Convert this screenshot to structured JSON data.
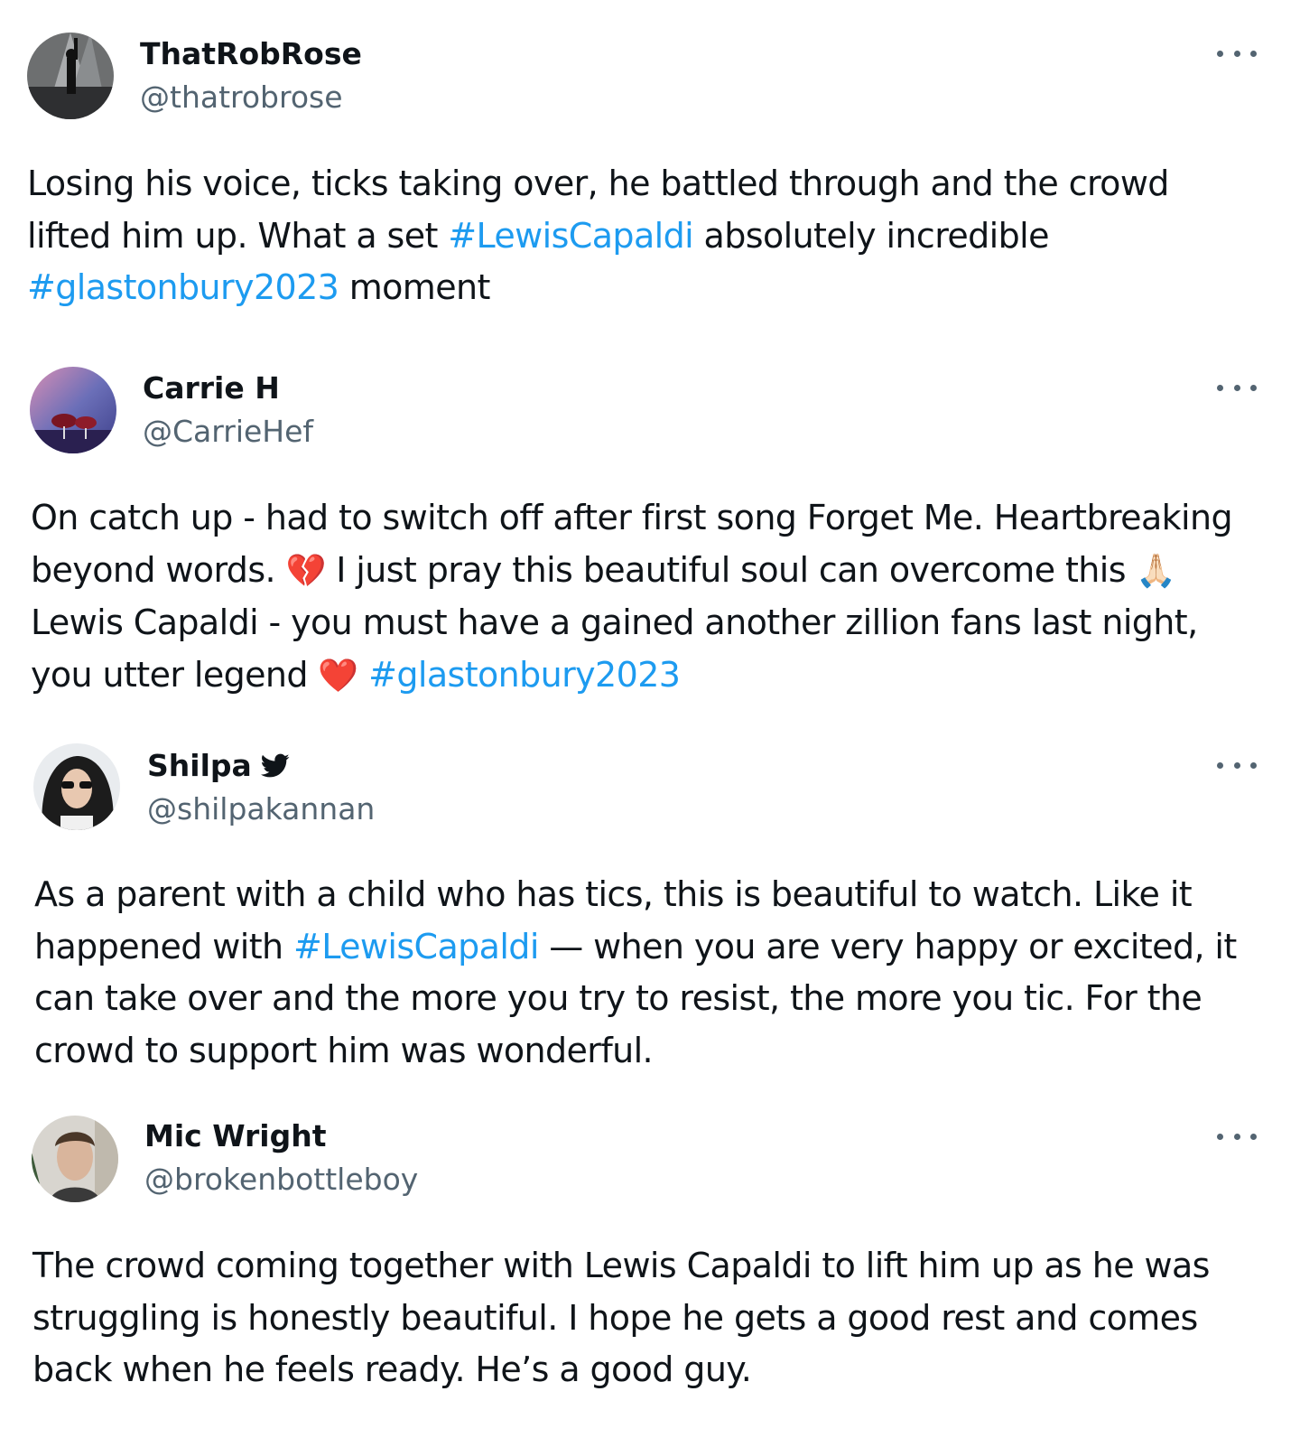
{
  "tweets": [
    {
      "name": "ThatRobRose",
      "handle": "@thatrobrose",
      "verified": false,
      "lines": [
        [
          {
            "t": "Losing his voice, ticks taking over, he battled through and the crowd"
          }
        ],
        [
          {
            "t": "lifted him up. What a set "
          },
          {
            "t": "#LewisCapaldi",
            "tag": true
          },
          {
            "t": " absolutely incredible"
          }
        ],
        [
          {
            "t": "#glastonbury2023",
            "tag": true
          },
          {
            "t": " moment"
          }
        ]
      ]
    },
    {
      "name": "Carrie H",
      "handle": "@CarrieHef",
      "verified": false,
      "lines": [
        [
          {
            "t": "On catch up - had to switch off after first song Forget Me. Heartbreaking"
          }
        ],
        [
          {
            "t": "beyond words. "
          },
          {
            "t": "💔",
            "emoji": true
          },
          {
            "t": " I just pray this beautiful soul can overcome this "
          },
          {
            "t": "🙏🏻",
            "emoji": true
          }
        ],
        [
          {
            "t": "Lewis Capaldi - you must have a gained another zillion fans last night,"
          }
        ],
        [
          {
            "t": "you utter legend "
          },
          {
            "t": "❤️",
            "emoji": true
          },
          {
            "t": " "
          },
          {
            "t": "#glastonbury2023",
            "tag": true
          }
        ]
      ]
    },
    {
      "name": "Shilpa",
      "handle": "@shilpakannan",
      "verified": true,
      "lines": [
        [
          {
            "t": "As a parent with a child who has tics, this is beautiful to watch. Like it"
          }
        ],
        [
          {
            "t": "happened with "
          },
          {
            "t": "#LewisCapaldi",
            "tag": true
          },
          {
            "t": " — when you are very happy or excited, it"
          }
        ],
        [
          {
            "t": "can take over and the more you try to resist, the more you tic. For the"
          }
        ],
        [
          {
            "t": "crowd to support him was wonderful."
          }
        ]
      ]
    },
    {
      "name": "Mic Wright",
      "handle": "@brokenbottleboy",
      "verified": false,
      "lines": [
        [
          {
            "t": "The crowd coming together with Lewis Capaldi to lift him up as he was"
          }
        ],
        [
          {
            "t": "struggling is honestly beautiful. I hope he gets a good rest and comes"
          }
        ],
        [
          {
            "t": "back when he feels ready. He’s a good guy."
          }
        ]
      ]
    }
  ],
  "colors": {
    "text": "#0f1419",
    "secondary": "#536471",
    "hashtag": "#1d9bf0"
  },
  "icons": {
    "more": "more-dots-icon",
    "verified": "bird-badge-icon"
  }
}
